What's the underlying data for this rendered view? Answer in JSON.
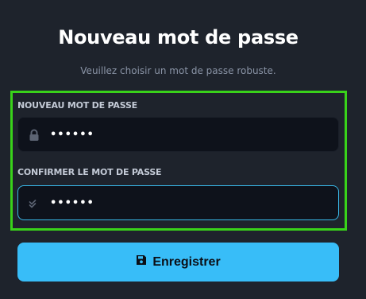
{
  "header": {
    "title": "Nouveau mot de passe",
    "subtitle": "Veuillez choisir un mot de passe robuste."
  },
  "form": {
    "new_password": {
      "label": "NOUVEAU MOT DE PASSE",
      "value": "••••••",
      "icon": "lock-icon"
    },
    "confirm_password": {
      "label": "CONFIRMER LE MOT DE PASSE",
      "value": "••••••",
      "icon": "double-check-icon"
    },
    "save_button": {
      "label": "Enregistrer",
      "icon": "floppy-disk-icon"
    }
  },
  "colors": {
    "background": "#1e232c",
    "input_background": "#0e121b",
    "accent": "#38bdf8",
    "focus_border": "#38b6e6",
    "highlight_border": "#39d21a"
  }
}
